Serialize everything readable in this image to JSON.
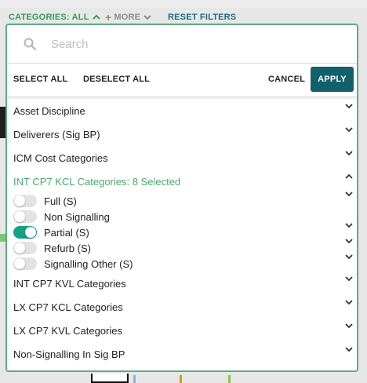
{
  "topbar": {
    "categories_label": "CATEGORIES: ALL",
    "more_label": "MORE",
    "reset_label": "RESET FILTERS"
  },
  "search": {
    "placeholder": "Search"
  },
  "actions": {
    "select_all": "SELECT ALL",
    "deselect_all": "DESELECT ALL",
    "cancel": "CANCEL",
    "apply": "APPLY"
  },
  "categories_before": [
    {
      "label": "Asset Discipline"
    },
    {
      "label": "Deliverers (Sig BP)"
    },
    {
      "label": "ICM Cost Categories"
    }
  ],
  "expanded_category": {
    "label": "INT CP7 KCL Categories: 8 Selected",
    "options": [
      {
        "label": "Full (S)",
        "on": false
      },
      {
        "label": "Non Signalling",
        "on": false
      },
      {
        "label": "Partial (S)",
        "on": true
      },
      {
        "label": "Refurb (S)",
        "on": false
      },
      {
        "label": "Signalling Other (S)",
        "on": false
      }
    ]
  },
  "categories_after": [
    {
      "label": "INT CP7 KVL Categories"
    },
    {
      "label": "LX CP7 KCL Categories"
    },
    {
      "label": "LX CP7 KVL Categories"
    },
    {
      "label": "Non-Signalling In Sig BP"
    }
  ],
  "colors": {
    "accent_green": "#4aa86e",
    "toggle_on": "#16a085",
    "apply_bg": "#11606c",
    "reset_link": "#1e6b78"
  },
  "icons": [
    "search-icon",
    "chevron-up-icon",
    "chevron-down-icon",
    "plus-icon"
  ]
}
